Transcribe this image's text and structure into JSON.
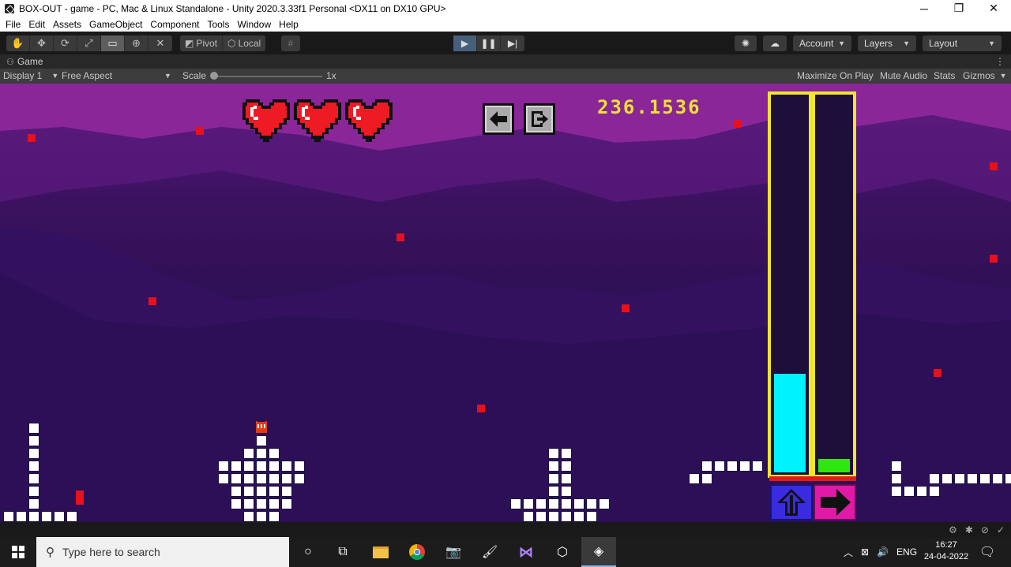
{
  "window": {
    "title": "BOX-OUT - game - PC, Mac & Linux Standalone - Unity 2020.3.33f1 Personal <DX11 on DX10 GPU>",
    "minimize_glyph": "─",
    "maximize_glyph": "❐",
    "close_glyph": "✕"
  },
  "menu": [
    "File",
    "Edit",
    "Assets",
    "GameObject",
    "Component",
    "Tools",
    "Window",
    "Help"
  ],
  "toolbar": {
    "transform_tools": [
      "hand-tool",
      "move-tool",
      "rotate-tool",
      "scale-tool",
      "rect-tool",
      "transform-tool",
      "custom-tool"
    ],
    "pivot_label": "Pivot",
    "local_label": "Local",
    "account_label": "Account",
    "layers_label": "Layers",
    "layout_label": "Layout"
  },
  "game_tab": {
    "label": "Game"
  },
  "game_controls": {
    "display": "Display 1",
    "aspect": "Free Aspect",
    "scale_label": "Scale",
    "scale_value": "1x",
    "maximize": "Maximize On Play",
    "mute": "Mute Audio",
    "stats": "Stats",
    "gizmos": "Gizmos"
  },
  "game": {
    "hearts": 3,
    "score": "236.1536",
    "meters": [
      {
        "name": "jump-meter",
        "fill_fraction": 0.26,
        "color": "#00f2ff"
      },
      {
        "name": "dash-meter",
        "fill_fraction": 0.035,
        "color": "#30e610"
      }
    ],
    "accent_red": "#e8101a",
    "meter_border": "#f1e62a"
  },
  "taskbar": {
    "search_placeholder": "Type here to search",
    "language": "ENG",
    "time": "16:27",
    "date": "24-04-2022"
  }
}
